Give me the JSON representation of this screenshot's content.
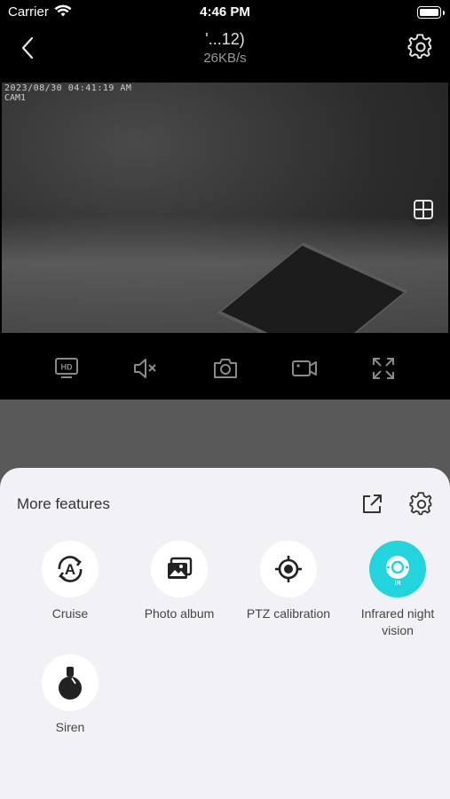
{
  "status_bar": {
    "carrier": "Carrier",
    "time": "4:46 PM"
  },
  "nav": {
    "title": "'...12)",
    "speed": "26KB/s"
  },
  "video": {
    "timestamp": "2023/08/30 04:41:19 AM",
    "camera_label": "CAM1"
  },
  "sheet": {
    "title": "More features",
    "features": [
      {
        "label": "Cruise",
        "icon": "cruise-icon",
        "active": false
      },
      {
        "label": "Photo album",
        "icon": "photo-album-icon",
        "active": false
      },
      {
        "label": "PTZ calibration",
        "icon": "ptz-calibration-icon",
        "active": false
      },
      {
        "label": "Infrared night vision",
        "icon": "infrared-icon",
        "active": true
      },
      {
        "label": "Siren",
        "icon": "siren-icon",
        "active": false
      }
    ],
    "infrared_badge": "IR",
    "cruise_letter": "A"
  },
  "colors": {
    "accent": "#22d4dc",
    "sheet_bg": "#f2f2f6",
    "toolbar_bg": "#000000"
  },
  "toolbar": {
    "hd_label": "HD"
  }
}
